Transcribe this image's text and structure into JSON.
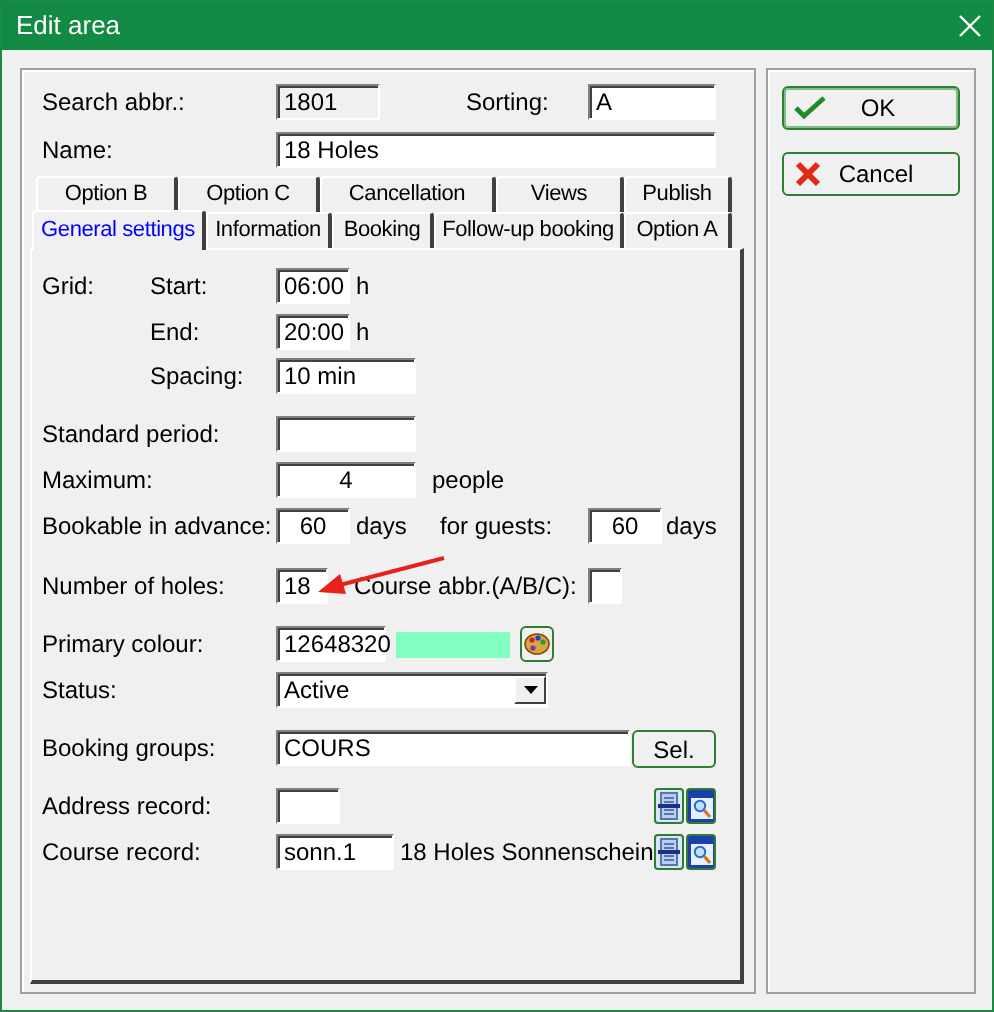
{
  "window": {
    "title": "Edit area"
  },
  "search_abbr": {
    "label": "Search abbr.:",
    "value": "1801"
  },
  "sorting": {
    "label": "Sorting:",
    "value": "A"
  },
  "name": {
    "label": "Name:",
    "value": "18 Holes"
  },
  "tab_rows": [
    [
      {
        "label": "Option B",
        "selected": false
      },
      {
        "label": "Option C",
        "selected": false
      },
      {
        "label": "Cancellation",
        "selected": false
      },
      {
        "label": "Views",
        "selected": false
      },
      {
        "label": "Publish",
        "selected": false
      }
    ],
    [
      {
        "label": "General settings",
        "selected": true
      },
      {
        "label": "Information",
        "selected": false
      },
      {
        "label": "Booking",
        "selected": false
      },
      {
        "label": "Follow-up booking",
        "selected": false
      },
      {
        "label": "Option A",
        "selected": false
      }
    ]
  ],
  "grid": {
    "label": "Grid:",
    "start": {
      "label": "Start:",
      "value": "06:00",
      "unit": "h"
    },
    "end": {
      "label": "End:",
      "value": "20:00",
      "unit": "h"
    },
    "spacing": {
      "label": "Spacing:",
      "value": "10 min"
    }
  },
  "standard_period": {
    "label": "Standard period:"
  },
  "maximum": {
    "label": "Maximum:",
    "value": "4",
    "unit": "people"
  },
  "bookable": {
    "label": "Bookable in advance:",
    "value": "60",
    "unit": "days",
    "guests_label": "for guests:",
    "guests_value": "60",
    "guests_unit": "days"
  },
  "holes": {
    "label": "Number of holes:",
    "value": "18",
    "course_abbr_label": "Course abbr.(A/B/C):"
  },
  "primary_colour": {
    "label": "Primary colour:",
    "value": "12648320",
    "color": "#80ffc0"
  },
  "status": {
    "label": "Status:",
    "value": "Active"
  },
  "booking_groups": {
    "label": "Booking groups:",
    "value": "COURS",
    "button": "Sel."
  },
  "address_record": {
    "label": "Address record:"
  },
  "course_record": {
    "label": "Course record:",
    "value": "sonn.1",
    "description": "18 Holes Sonnenschein"
  },
  "buttons": [
    {
      "label": "OK",
      "kind": "ok"
    },
    {
      "label": "Cancel",
      "kind": "cancel"
    }
  ]
}
